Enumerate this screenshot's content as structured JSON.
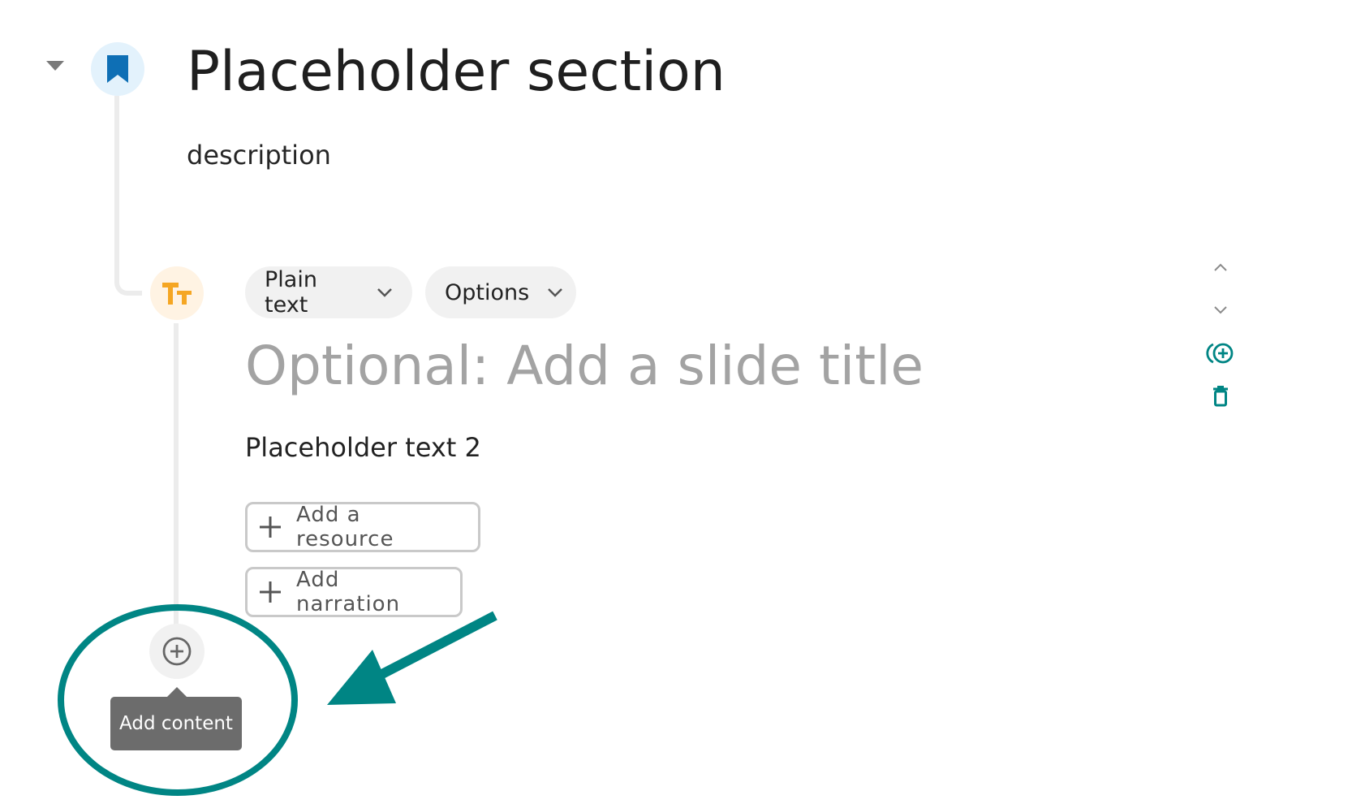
{
  "section": {
    "title": "Placeholder section",
    "description": "description",
    "icon": "bookmark-icon",
    "icon_color": "#0e6fb5"
  },
  "slide": {
    "type_label": "Plain text",
    "options_label": "Options",
    "title_placeholder": "Optional: Add a slide title",
    "body_text": "Placeholder text 2",
    "icon": "text-size-icon",
    "icon_color": "#f5a623"
  },
  "buttons": {
    "add_resource": "Add a resource",
    "add_narration": "Add narration"
  },
  "side_controls": [
    "move-up-icon",
    "move-down-icon",
    "duplicate-icon",
    "delete-icon"
  ],
  "add_content": {
    "tooltip": "Add content",
    "icon": "plus-circle-icon"
  },
  "colors": {
    "accent": "#008584",
    "annotation": "#008584"
  }
}
